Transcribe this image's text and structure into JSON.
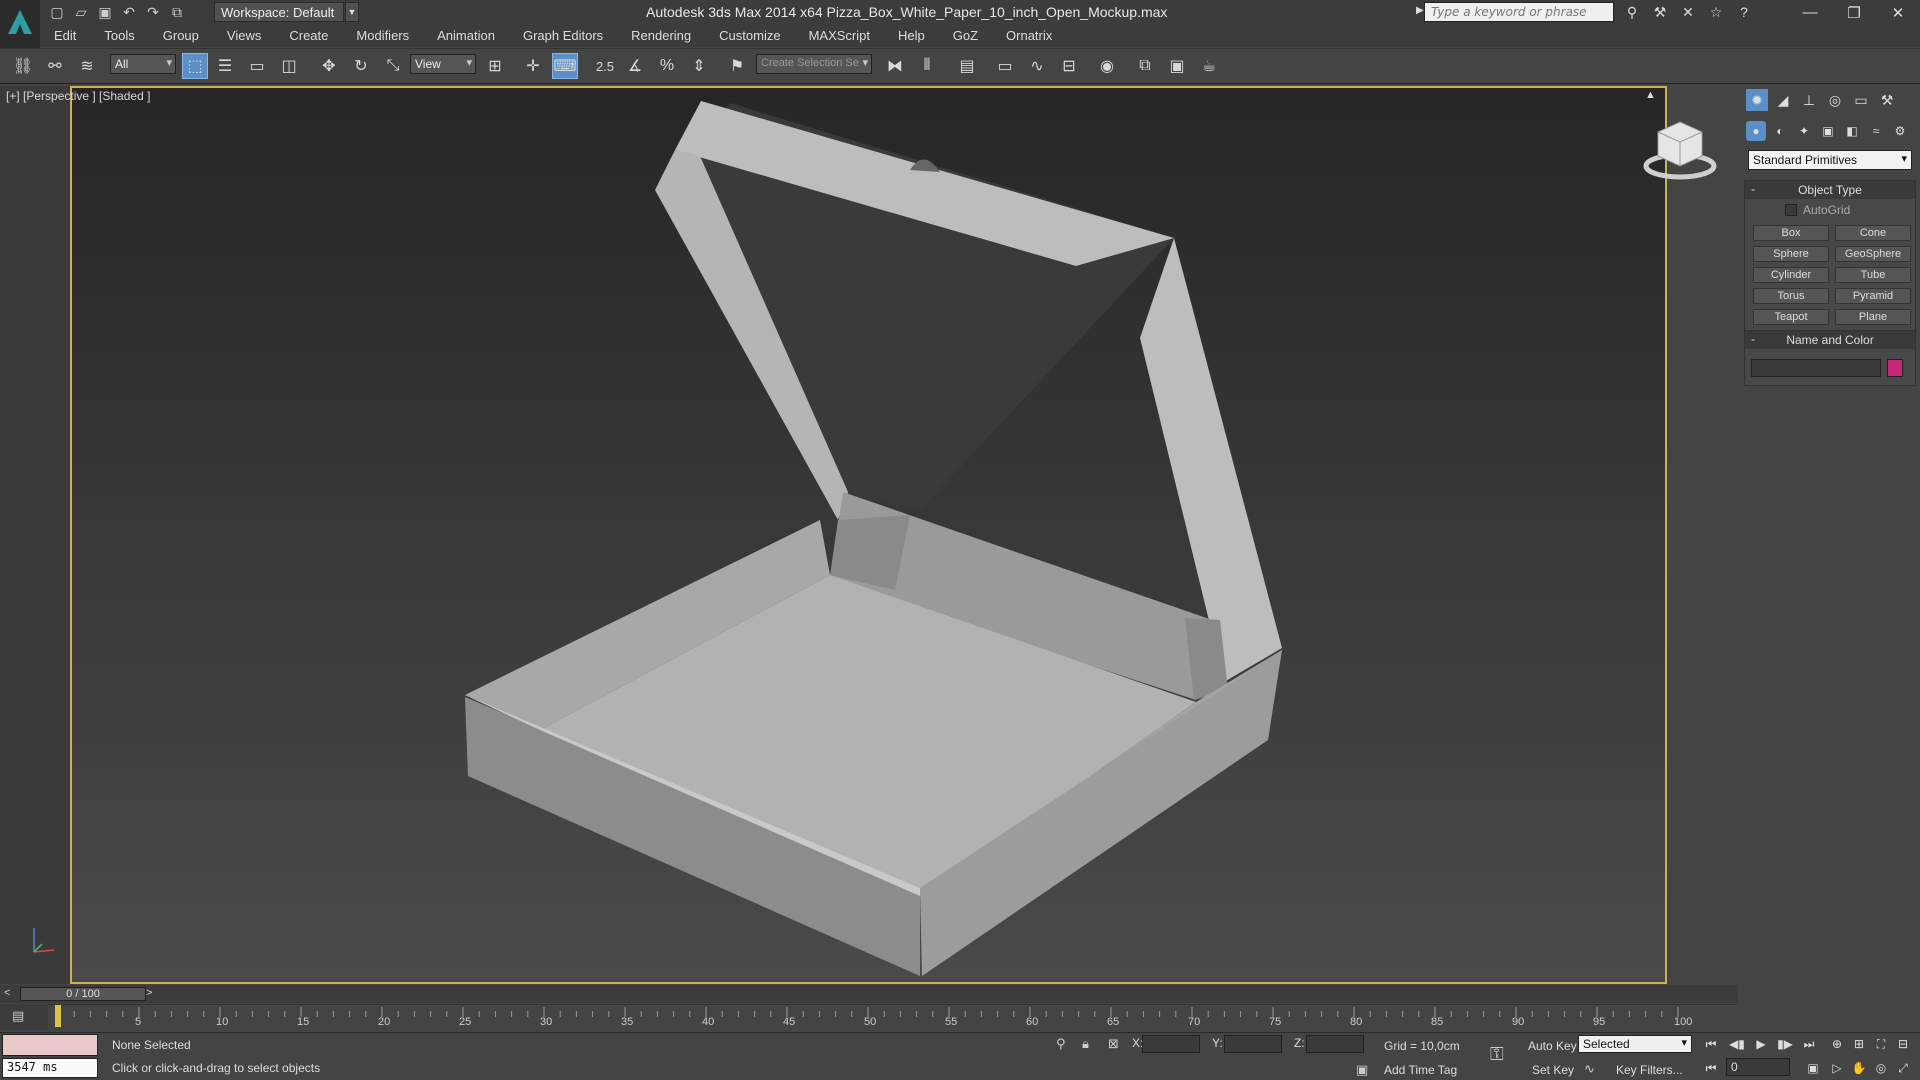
{
  "window": {
    "title": "Autodesk 3ds Max  2014 x64      Pizza_Box_White_Paper_10_inch_Open_Mockup.max",
    "workspace": "Workspace: Default",
    "search_placeholder": "Type a keyword or phrase"
  },
  "menu": [
    "Edit",
    "Tools",
    "Group",
    "Views",
    "Create",
    "Modifiers",
    "Animation",
    "Graph Editors",
    "Rendering",
    "Customize",
    "MAXScript",
    "Help",
    "GoZ",
    "Ornatrix"
  ],
  "toolbar": {
    "filter": "All",
    "ref_coord": "View",
    "snap_value": "2.5",
    "selection_set": "Create Selection Se"
  },
  "viewport": {
    "label": "[+] [Perspective ] [Shaded ]"
  },
  "command_panel": {
    "category": "Standard Primitives",
    "object_type_title": "Object Type",
    "autogrid": "AutoGrid",
    "buttons": [
      "Box",
      "Cone",
      "Sphere",
      "GeoSphere",
      "Cylinder",
      "Tube",
      "Torus",
      "Pyramid",
      "Teapot",
      "Plane"
    ],
    "name_color_title": "Name and Color",
    "object_color": "#c8287a"
  },
  "timeline": {
    "slider": "0 / 100",
    "ticks": [
      "5",
      "10",
      "15",
      "20",
      "25",
      "30",
      "35",
      "40",
      "45",
      "50",
      "55",
      "60",
      "65",
      "70",
      "75",
      "80",
      "85",
      "90",
      "95",
      "100"
    ]
  },
  "status": {
    "script_output": "3547 ms",
    "selection": "None Selected",
    "prompt": "Click or click-and-drag to select objects",
    "x_label": "X:",
    "y_label": "Y:",
    "z_label": "Z:",
    "grid": "Grid = 10,0cm",
    "add_time_tag": "Add Time Tag",
    "auto_key": "Auto Key",
    "set_key": "Set Key",
    "selected": "Selected",
    "key_filters": "Key Filters...",
    "frame": "0"
  }
}
